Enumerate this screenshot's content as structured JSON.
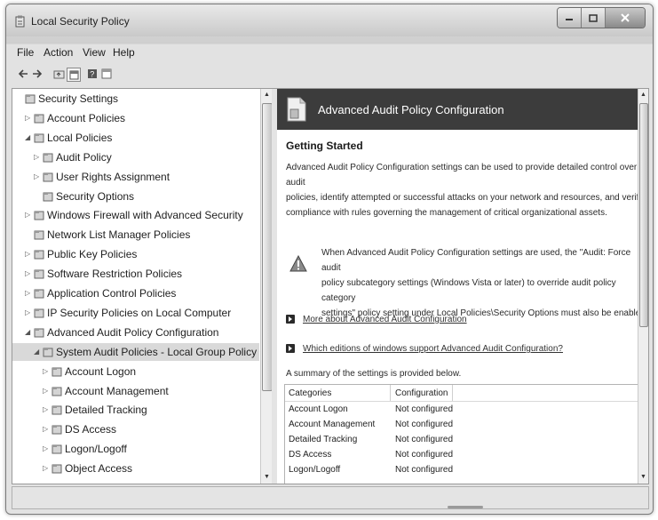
{
  "window": {
    "title": "Local Security Policy"
  },
  "menu": [
    "File",
    "Action",
    "View",
    "Help"
  ],
  "toolbar": {
    "icons": [
      "back-icon",
      "forward-icon",
      "up-folder-icon",
      "properties-icon",
      "help-icon",
      "console-icon"
    ]
  },
  "tree": [
    {
      "label": "Security Settings",
      "icon": "security-settings-icon",
      "expander": ""
    },
    {
      "label": "Account Policies",
      "icon": "policy-folder-icon",
      "expander": "▷"
    },
    {
      "label": "Local Policies",
      "icon": "policy-folder-icon",
      "expander": "◢"
    },
    {
      "label": "Audit Policy",
      "icon": "policy-folder-icon",
      "expander": "▷"
    },
    {
      "label": "User Rights Assignment",
      "icon": "policy-folder-icon",
      "expander": "▷"
    },
    {
      "label": "Security Options",
      "icon": "policy-folder-icon",
      "expander": ""
    },
    {
      "label": "Windows Firewall with Advanced Security",
      "icon": "firewall-icon",
      "expander": "▷"
    },
    {
      "label": "Network List Manager Policies",
      "icon": "network-icon",
      "expander": ""
    },
    {
      "label": "Public Key Policies",
      "icon": "folder-icon",
      "expander": "▷"
    },
    {
      "label": "Software Restriction Policies",
      "icon": "folder-icon",
      "expander": "▷"
    },
    {
      "label": "Application Control Policies",
      "icon": "folder-icon",
      "expander": "▷"
    },
    {
      "label": "IP Security Policies on Local Computer",
      "icon": "ip-security-icon",
      "expander": "▷"
    },
    {
      "label": "Advanced Audit Policy Configuration",
      "icon": "folder-icon",
      "expander": "◢"
    },
    {
      "label": "System Audit Policies - Local Group Policy Object",
      "icon": "audit-policy-icon",
      "expander": "◢"
    },
    {
      "label": "Account Logon",
      "icon": "audit-folder-icon",
      "expander": "▷"
    },
    {
      "label": "Account Management",
      "icon": "audit-folder-icon",
      "expander": "▷"
    },
    {
      "label": "Detailed Tracking",
      "icon": "audit-folder-icon",
      "expander": "▷"
    },
    {
      "label": "DS Access",
      "icon": "audit-folder-icon",
      "expander": "▷"
    },
    {
      "label": "Logon/Logoff",
      "icon": "audit-folder-icon",
      "expander": "▷"
    },
    {
      "label": "Object Access",
      "icon": "audit-folder-icon",
      "expander": "▷"
    }
  ],
  "pane": {
    "header_title": "Advanced Audit Policy Configuration",
    "section_title": "Getting Started",
    "intro_lines": [
      "Advanced Audit Policy Configuration settings can be used to provide detailed control over audit",
      "policies, identify attempted or successful attacks on your network and resources, and verify",
      "compliance with rules governing the management of critical organizational assets."
    ],
    "warning_lines": [
      "When Advanced Audit Policy Configuration settings are used, the \"Audit: Force audit",
      "policy subcategory settings (Windows Vista or later) to override audit policy category",
      "settings\" policy setting under Local Policies\\Security Options must also be enabled."
    ],
    "links": [
      "More about Advanced Audit Configuration",
      "Which editions of windows support Advanced Audit Configuration?"
    ],
    "summary_text": "A summary of the settings is provided below.",
    "table": {
      "headers": [
        "Categories",
        "Configuration"
      ],
      "rows": [
        [
          "Account Logon",
          "Not configured"
        ],
        [
          "Account Management",
          "Not configured"
        ],
        [
          "Detailed Tracking",
          "Not configured"
        ],
        [
          "DS Access",
          "Not configured"
        ],
        [
          "Logon/Logoff",
          "Not configured"
        ]
      ]
    }
  },
  "colors": {
    "header_bg": "#3c3c3c",
    "selection": "#d9d9d9",
    "window_frame": "#cfcfcf"
  }
}
